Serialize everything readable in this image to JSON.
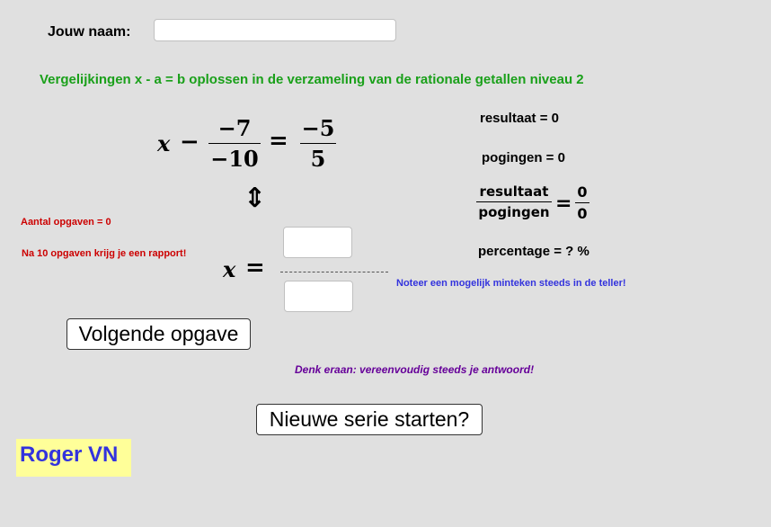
{
  "name_field": {
    "label": "Jouw naam:",
    "value": "",
    "placeholder": ""
  },
  "title": "Vergelijkingen x - a = b oplossen in de verzameling van de rationale getallen niveau 2",
  "equation": {
    "variable": "x",
    "operator": "−",
    "frac1": {
      "numerator": "−7",
      "denominator": "−10"
    },
    "equals": "=",
    "frac2": {
      "numerator": "−5",
      "denominator": "5"
    }
  },
  "equivalence_icon": "up-down-arrow-icon",
  "equivalence_glyph": "⇕",
  "stats": {
    "resultaat": "resultaat = 0",
    "pogingen": "pogingen = 0",
    "ratio": {
      "numerator_label": "resultaat",
      "denominator_label": "pogingen",
      "equals": "=",
      "numerator_value": "0",
      "denominator_value": "0"
    },
    "percentage": "percentage = ? %"
  },
  "info": {
    "aantal_opgaven": "Aantal opgaven = 0",
    "rapport": "Na 10 opgaven krijg je een rapport!"
  },
  "answer": {
    "variable": "x",
    "equals": "=",
    "numerator_value": "",
    "denominator_value": "",
    "note": "Noteer een mogelijk minteken steeds in de teller!"
  },
  "buttons": {
    "next": "Volgende opgave",
    "new_series": "Nieuwe serie starten?"
  },
  "hint": "Denk eraan: vereenvoudig steeds je antwoord!",
  "author": "Roger VN",
  "colors": {
    "background": "#e0e0e0",
    "title": "#1aa01a",
    "info_red": "#cc0000",
    "note_blue": "#3333dd",
    "hint_purple": "#660099",
    "author_bg": "#ffff99"
  }
}
